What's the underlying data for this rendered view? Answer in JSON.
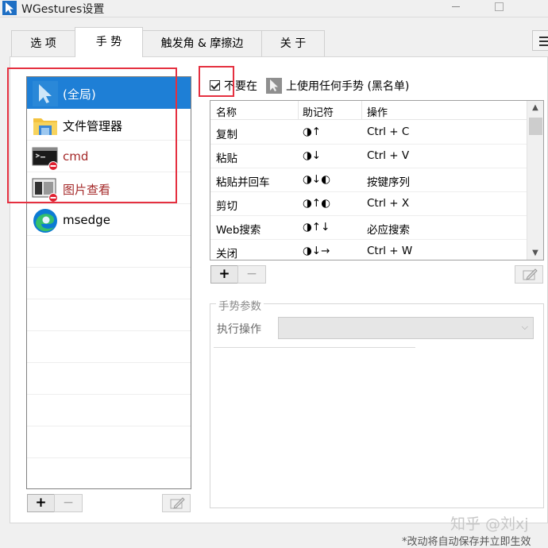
{
  "window": {
    "title": "WGestures设置"
  },
  "tabs": [
    {
      "label": "选 项"
    },
    {
      "label": "手 势"
    },
    {
      "label": "触发角 & 摩擦边"
    },
    {
      "label": "关 于"
    }
  ],
  "apps": [
    {
      "label": "(全局)",
      "icon": "cursor-icon"
    },
    {
      "label": "文件管理器",
      "icon": "folder-icon"
    },
    {
      "label": "cmd",
      "icon": "terminal-icon"
    },
    {
      "label": "图片查看",
      "icon": "photo-viewer-icon"
    },
    {
      "label": "msedge",
      "icon": "edge-icon"
    }
  ],
  "app_buttons": {
    "add": "+",
    "remove": "−"
  },
  "blacklist": {
    "prefix": "不要在",
    "suffix": "上使用任何手势 (黑名单)",
    "checked": true
  },
  "gesture_table": {
    "headers": [
      "名称",
      "助记符",
      "操作"
    ],
    "rows": [
      {
        "name": "复制",
        "mnemonic": "◑↑",
        "action": "Ctrl + C"
      },
      {
        "name": "粘贴",
        "mnemonic": "◑↓",
        "action": "Ctrl + V"
      },
      {
        "name": "粘贴并回车",
        "mnemonic": "◑↓◐",
        "action": "按键序列"
      },
      {
        "name": "剪切",
        "mnemonic": "◑↑◐",
        "action": "Ctrl + X"
      },
      {
        "name": "Web搜索",
        "mnemonic": "◑↑↓",
        "action": "必应搜索"
      },
      {
        "name": "关闭",
        "mnemonic": "◑↓→",
        "action": "Ctrl + W"
      }
    ]
  },
  "gesture_buttons": {
    "add": "+",
    "remove": "−"
  },
  "params": {
    "legend": "手势参数",
    "exec_label": "执行操作",
    "exec_value": ""
  },
  "watermark": "知乎 @刘xj",
  "footer": "*改动将自动保存并立即生效"
}
